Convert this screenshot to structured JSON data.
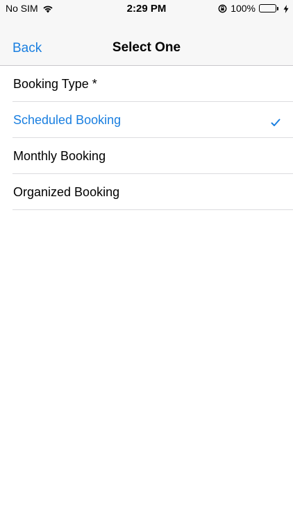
{
  "status_bar": {
    "carrier": "No SIM",
    "time": "2:29 PM",
    "battery_percent": "100%",
    "battery_level": 1.0,
    "icons": [
      "wifi-icon",
      "rotation-lock-icon",
      "battery-icon",
      "charging-bolt-icon"
    ]
  },
  "nav": {
    "back_label": "Back",
    "title": "Select One"
  },
  "list": {
    "header": "Booking Type *",
    "options": [
      {
        "label": "Scheduled Booking",
        "selected": true
      },
      {
        "label": "Monthly Booking",
        "selected": false
      },
      {
        "label": "Organized Booking",
        "selected": false
      }
    ]
  },
  "colors": {
    "accent": "#1a7fe0",
    "battery": "#4cd964",
    "bar_background": "#f7f7f7"
  }
}
